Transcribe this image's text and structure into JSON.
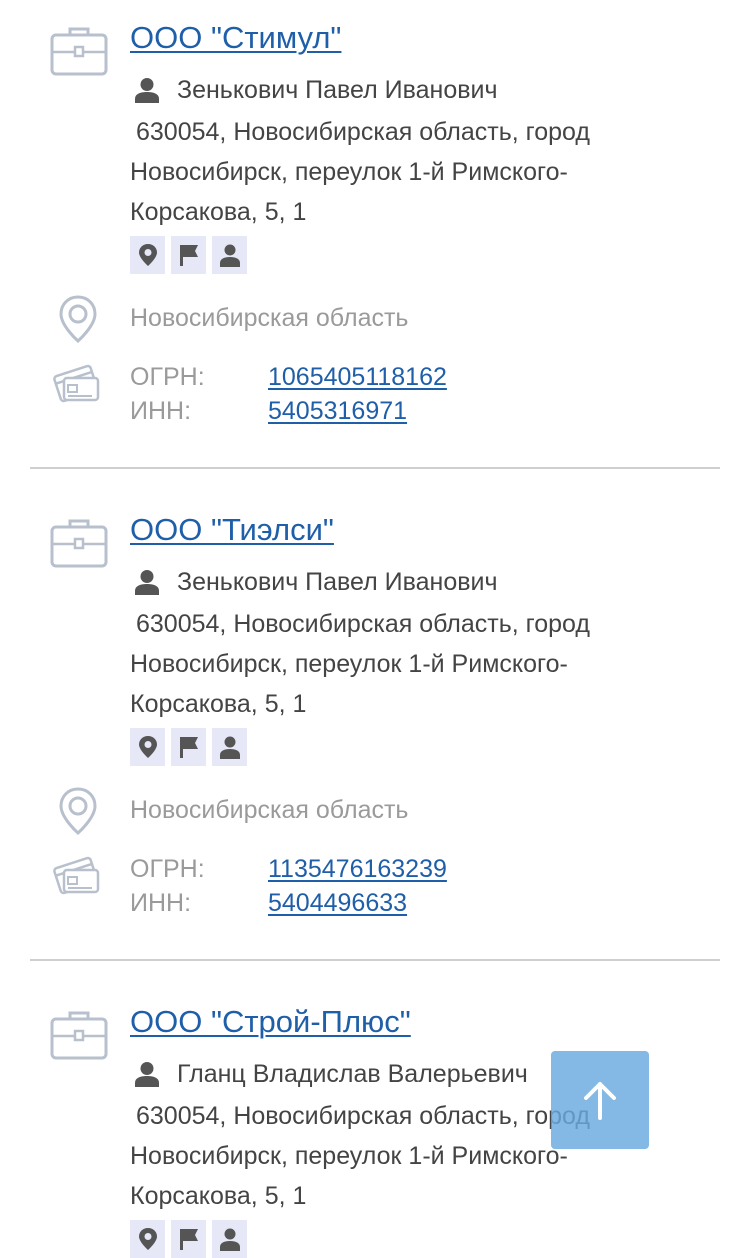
{
  "labels": {
    "ogrn": "ОГРН:",
    "inn": "ИНН:"
  },
  "companies": [
    {
      "name": "ООО \"Стимул\"",
      "director": "Зенькович Павел Иванович",
      "address": "630054, Новосибирская область, город Новосибирск, переулок 1-й Римского-Корсакова, 5, 1",
      "region": "Новосибирская область",
      "ogrn": "1065405118162",
      "inn": "5405316971"
    },
    {
      "name": "ООО \"Тиэлси\"",
      "director": "Зенькович Павел Иванович",
      "address": "630054, Новосибирская область, город Новосибирск, переулок 1-й Римского-Корсакова, 5, 1",
      "region": "Новосибирская область",
      "ogrn": "1135476163239",
      "inn": "5404496633"
    },
    {
      "name": "ООО \"Строй-Плюс\"",
      "director": "Гланц Владислав Валерьевич",
      "address": "630054, Новосибирская область, город Новосибирск, переулок 1-й Римского-Корсакова, 5, 1"
    }
  ],
  "colors": {
    "link": "#1f5ea8",
    "muted": "#9a9a9a",
    "icon": "#b7c0cc",
    "tag_bg": "#e6e7f7",
    "scroll_button": "#68aade"
  },
  "icons": {
    "company": "briefcase-icon",
    "person": "person-icon",
    "region": "location-pin-icon",
    "registry": "card-icon",
    "scroll": "arrow-up-icon"
  }
}
